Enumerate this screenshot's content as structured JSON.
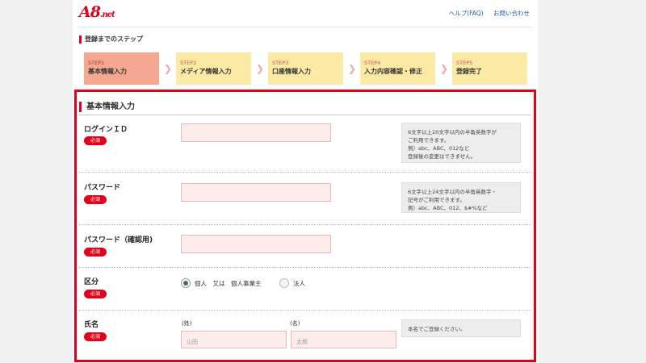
{
  "header": {
    "logo_main": "A8",
    "logo_sub": ".net",
    "links": [
      "ヘルプ(FAQ)",
      "お問い合わせ"
    ]
  },
  "steps_title": "登録までのステップ",
  "steps": [
    {
      "num": "STEP1",
      "label": "基本情報入力",
      "active": true
    },
    {
      "num": "STEP2",
      "label": "メディア情報入力",
      "active": false
    },
    {
      "num": "STEP3",
      "label": "口座情報入力",
      "active": false
    },
    {
      "num": "STEP4",
      "label": "入力内容確認・修正",
      "active": false
    },
    {
      "num": "STEP5",
      "label": "登録完了",
      "active": false
    }
  ],
  "arrow_glyph": "❯",
  "section_title": "基本情報入力",
  "required_label": "必須",
  "fields": {
    "login_id": {
      "label": "ログインＩＤ",
      "value": "",
      "help": [
        "6文字以上20文字以内の半角英数字が",
        "ご利用できます。",
        "例）abc、ABC、012など",
        "登録後の変更はできません。"
      ]
    },
    "password": {
      "label": "パスワード",
      "value": "",
      "help": [
        "6文字以上24文字以内の半角英数字・",
        "記号がご利用できます。",
        "例）abc、ABC、012、$#%など"
      ]
    },
    "password_confirm": {
      "label": "パスワード（確認用)",
      "value": ""
    },
    "category": {
      "label": "区分",
      "options": [
        {
          "label": "個人　又は　個人事業主",
          "selected": true
        },
        {
          "label": "法人",
          "selected": false
        }
      ]
    },
    "name": {
      "label": "氏名",
      "last_label": "(姓)",
      "first_label": "(名)",
      "last_placeholder": "山田",
      "first_placeholder": "太郎",
      "help": [
        "本名でご登録ください。"
      ]
    }
  },
  "colors": {
    "brand": "#e3001b",
    "step_active": "#f5a88f",
    "step_inactive": "#fbe9a4",
    "input_bg": "#fdecec"
  }
}
